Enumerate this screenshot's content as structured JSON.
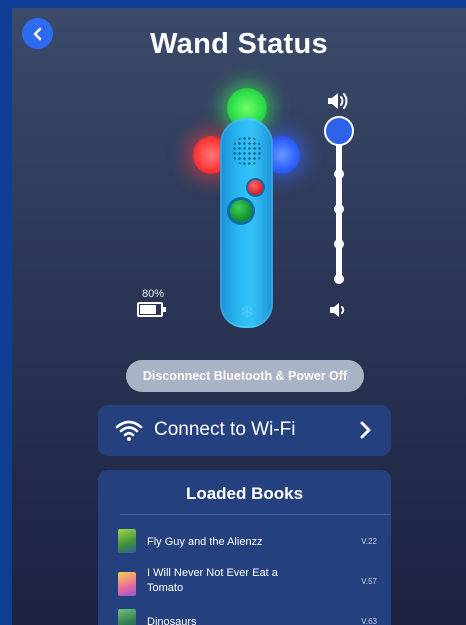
{
  "header": {
    "title": "Wand Status",
    "back_icon": "chevron-left-icon"
  },
  "colors": {
    "accent_blue": "#2e6bf0",
    "card_bg": "#25407e",
    "wand_body": "#2ab8f2",
    "led_green": "#2fe04a",
    "led_red": "#ff3a3a",
    "led_blue": "#2f62ff"
  },
  "wand": {
    "leds": [
      "green",
      "red",
      "blue"
    ],
    "battery_label": "80%",
    "battery_level": 0.8
  },
  "volume": {
    "up_icon": "volume-up-icon",
    "down_icon": "volume-down-icon",
    "level": 1.0
  },
  "actions": {
    "disconnect_label": "Disconnect Bluetooth & Power Off"
  },
  "wifi": {
    "label": "Connect to Wi-Fi",
    "icon": "wifi-icon",
    "chevron_icon": "chevron-right-icon"
  },
  "books": {
    "title": "Loaded Books",
    "items": [
      {
        "title": "Fly Guy and the Alienzz",
        "version": "V.22"
      },
      {
        "title": "I Will Never Not Ever Eat a Tomato",
        "version": "V.57"
      },
      {
        "title": "Dinosaurs",
        "version": "V.63"
      }
    ]
  }
}
